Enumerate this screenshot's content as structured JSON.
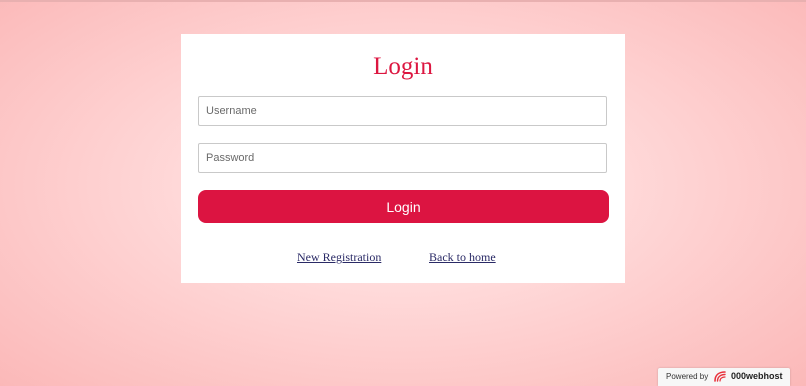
{
  "form": {
    "title": "Login",
    "username_placeholder": "Username",
    "password_placeholder": "Password",
    "submit_label": "Login"
  },
  "links": {
    "register": "New Registration",
    "home": "Back to home"
  },
  "footer": {
    "powered_by": "Powered by",
    "host_name": "000webhost"
  },
  "colors": {
    "accent": "#dc1441",
    "title": "#dc1640",
    "background": "#fbc4c4",
    "link": "#2a2a66"
  },
  "icons": {
    "host_logo": "000webhost-logo-icon"
  }
}
